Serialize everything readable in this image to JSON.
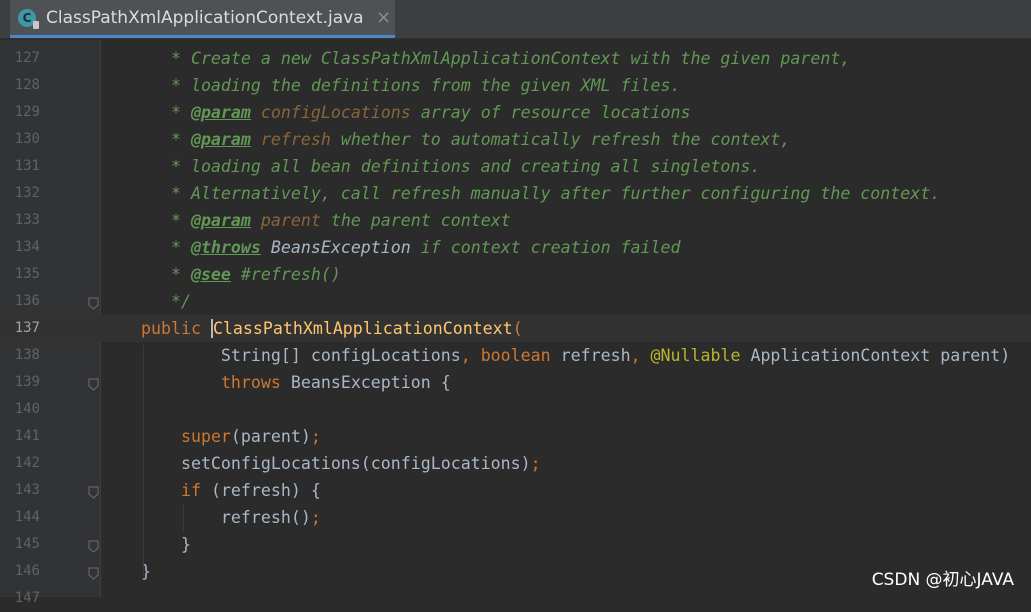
{
  "tab": {
    "icon_letter": "C",
    "title": "ClassPathXmlApplicationContext.java",
    "close_glyph": "×"
  },
  "lines": [
    {
      "no": "127",
      "current": false,
      "fold": false,
      "tokens": [
        {
          "t": "   * Create a new ClassPathXmlApplicationContext with the given parent,",
          "c": "doc"
        }
      ]
    },
    {
      "no": "128",
      "current": false,
      "fold": false,
      "tokens": [
        {
          "t": "   * loading the definitions from the given XML files.",
          "c": "doc"
        }
      ]
    },
    {
      "no": "129",
      "current": false,
      "fold": false,
      "tokens": [
        {
          "t": "   * ",
          "c": "doc"
        },
        {
          "t": "@param",
          "c": "tag"
        },
        {
          "t": " ",
          "c": "doc"
        },
        {
          "t": "configLocations",
          "c": "par"
        },
        {
          "t": " array of resource locations",
          "c": "doc"
        }
      ]
    },
    {
      "no": "130",
      "current": false,
      "fold": false,
      "tokens": [
        {
          "t": "   * ",
          "c": "doc"
        },
        {
          "t": "@param",
          "c": "tag"
        },
        {
          "t": " ",
          "c": "doc"
        },
        {
          "t": "refresh",
          "c": "par"
        },
        {
          "t": " whether to automatically refresh the context,",
          "c": "doc"
        }
      ]
    },
    {
      "no": "131",
      "current": false,
      "fold": false,
      "tokens": [
        {
          "t": "   * loading all bean definitions and creating all singletons.",
          "c": "doc"
        }
      ]
    },
    {
      "no": "132",
      "current": false,
      "fold": false,
      "tokens": [
        {
          "t": "   * Alternatively, call refresh manually after further configuring the context.",
          "c": "doc"
        }
      ]
    },
    {
      "no": "133",
      "current": false,
      "fold": false,
      "tokens": [
        {
          "t": "   * ",
          "c": "doc"
        },
        {
          "t": "@param",
          "c": "tag"
        },
        {
          "t": " ",
          "c": "doc"
        },
        {
          "t": "parent",
          "c": "par"
        },
        {
          "t": " the parent context",
          "c": "doc"
        }
      ]
    },
    {
      "no": "134",
      "current": false,
      "fold": false,
      "tokens": [
        {
          "t": "   * ",
          "c": "doc"
        },
        {
          "t": "@throws",
          "c": "tag"
        },
        {
          "t": " ",
          "c": "doc"
        },
        {
          "t": "BeansException",
          "c": "ref"
        },
        {
          "t": " if context creation failed",
          "c": "doc"
        }
      ]
    },
    {
      "no": "135",
      "current": false,
      "fold": false,
      "tokens": [
        {
          "t": "   * ",
          "c": "doc"
        },
        {
          "t": "@see",
          "c": "tag"
        },
        {
          "t": " #refresh()",
          "c": "doc"
        }
      ]
    },
    {
      "no": "136",
      "current": false,
      "fold": true,
      "tokens": [
        {
          "t": "   */",
          "c": "doc"
        }
      ]
    },
    {
      "no": "137",
      "current": true,
      "fold": false,
      "tokens": [
        {
          "t": "public ",
          "c": "kw"
        },
        {
          "t": "",
          "c": "caret"
        },
        {
          "t": "ClassPathXmlApplicationContext",
          "c": "ctor"
        },
        {
          "t": "(",
          "c": "kw"
        }
      ]
    },
    {
      "no": "138",
      "current": false,
      "fold": false,
      "tokens": [
        {
          "t": "        String[] configLocations",
          "c": "plain"
        },
        {
          "t": ", ",
          "c": "kw"
        },
        {
          "t": "boolean ",
          "c": "kw"
        },
        {
          "t": "refresh",
          "c": "plain"
        },
        {
          "t": ", ",
          "c": "kw"
        },
        {
          "t": "@Nullable ",
          "c": "ann"
        },
        {
          "t": "ApplicationContext parent)",
          "c": "plain"
        }
      ]
    },
    {
      "no": "139",
      "current": false,
      "fold": true,
      "tokens": [
        {
          "t": "        ",
          "c": "plain"
        },
        {
          "t": "throws ",
          "c": "kw"
        },
        {
          "t": "BeansException {",
          "c": "plain"
        }
      ]
    },
    {
      "no": "140",
      "current": false,
      "fold": false,
      "tokens": []
    },
    {
      "no": "141",
      "current": false,
      "fold": false,
      "tokens": [
        {
          "t": "    ",
          "c": "plain"
        },
        {
          "t": "super",
          "c": "kw"
        },
        {
          "t": "(parent)",
          "c": "plain"
        },
        {
          "t": ";",
          "c": "kw"
        }
      ]
    },
    {
      "no": "142",
      "current": false,
      "fold": false,
      "tokens": [
        {
          "t": "    setConfigLocations(configLocations)",
          "c": "plain"
        },
        {
          "t": ";",
          "c": "kw"
        }
      ]
    },
    {
      "no": "143",
      "current": false,
      "fold": true,
      "tokens": [
        {
          "t": "    ",
          "c": "plain"
        },
        {
          "t": "if ",
          "c": "kw"
        },
        {
          "t": "(refresh) {",
          "c": "plain"
        }
      ]
    },
    {
      "no": "144",
      "current": false,
      "fold": false,
      "tokens": [
        {
          "t": "        refresh()",
          "c": "plain"
        },
        {
          "t": ";",
          "c": "kw"
        }
      ]
    },
    {
      "no": "145",
      "current": false,
      "fold": true,
      "tokens": [
        {
          "t": "    }",
          "c": "plain"
        }
      ]
    },
    {
      "no": "146",
      "current": false,
      "fold": true,
      "tokens": [
        {
          "t": "}",
          "c": "plain"
        }
      ]
    },
    {
      "no": "147",
      "current": false,
      "fold": false,
      "tokens": []
    }
  ],
  "watermark": "CSDN @初心JAVA"
}
